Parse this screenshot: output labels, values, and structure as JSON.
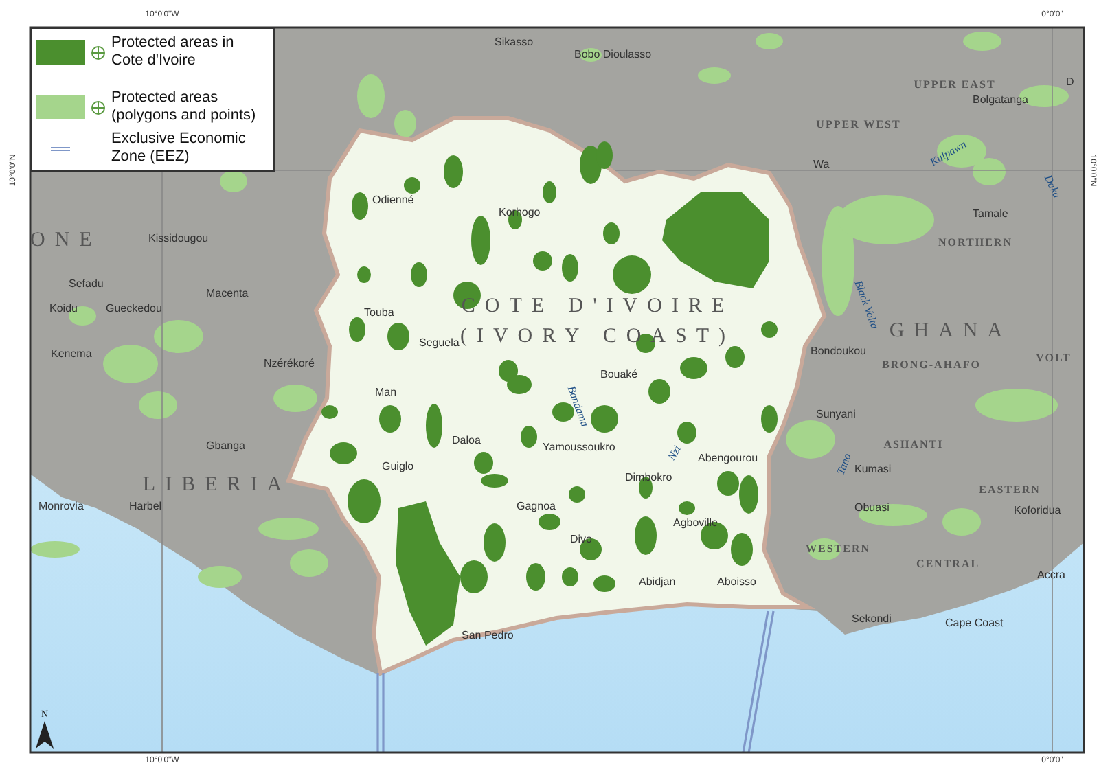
{
  "legend": {
    "items": [
      {
        "kind": "patch",
        "color": "#4b8f2e",
        "label": "Protected areas in Cote d'Ivoire"
      },
      {
        "kind": "patch",
        "color": "#a5d58c",
        "label": "Protected areas (polygons and points)"
      },
      {
        "kind": "line",
        "color": "#7f97c8",
        "label": "Exclusive Economic Zone (EEZ)"
      }
    ]
  },
  "grid_labels": {
    "top": [
      "10°0'0\"W",
      "0°0'0\""
    ],
    "bottom": [
      "10°0'0\"W",
      "0°0'0\""
    ],
    "left": [
      "10°0'0\"N"
    ],
    "right": [
      "10°0'0\"N"
    ]
  },
  "map_labels": [
    {
      "text": "COTE D'IVOIRE",
      "kind": "country"
    },
    {
      "text": "(IVORY COAST)",
      "kind": "country"
    },
    {
      "text": "LIBERIA",
      "kind": "country"
    },
    {
      "text": "GHANA",
      "kind": "country"
    },
    {
      "text": "ONE",
      "kind": "country"
    },
    {
      "text": "UPPER EAST",
      "kind": "region"
    },
    {
      "text": "UPPER WEST",
      "kind": "region"
    },
    {
      "text": "NORTHERN",
      "kind": "region"
    },
    {
      "text": "BRONG-AHAFO",
      "kind": "region"
    },
    {
      "text": "ASHANTI",
      "kind": "region"
    },
    {
      "text": "EASTERN",
      "kind": "region"
    },
    {
      "text": "WESTERN",
      "kind": "region"
    },
    {
      "text": "CENTRAL",
      "kind": "region"
    },
    {
      "text": "VOLT",
      "kind": "region"
    },
    {
      "text": "Kulpawn",
      "kind": "river"
    },
    {
      "text": "Daka",
      "kind": "river"
    },
    {
      "text": "Black Volta",
      "kind": "river"
    },
    {
      "text": "Bandama",
      "kind": "river"
    },
    {
      "text": "Nzi",
      "kind": "river"
    },
    {
      "text": "Tano",
      "kind": "river"
    },
    {
      "text": "Sikasso",
      "kind": "city"
    },
    {
      "text": "Bobo Dioulasso",
      "kind": "city"
    },
    {
      "text": "D",
      "kind": "city"
    },
    {
      "text": "Bolgatanga",
      "kind": "city"
    },
    {
      "text": "Wa",
      "kind": "city"
    },
    {
      "text": "Tamale",
      "kind": "city"
    },
    {
      "text": "Odienné",
      "kind": "city"
    },
    {
      "text": "Korhogo",
      "kind": "city"
    },
    {
      "text": "Kissidougou",
      "kind": "city"
    },
    {
      "text": "Sefadu",
      "kind": "city"
    },
    {
      "text": "Koidu",
      "kind": "city"
    },
    {
      "text": "Gueckedou",
      "kind": "city"
    },
    {
      "text": "Macenta",
      "kind": "city"
    },
    {
      "text": "Kenema",
      "kind": "city"
    },
    {
      "text": "Touba",
      "kind": "city"
    },
    {
      "text": "Seguela",
      "kind": "city"
    },
    {
      "text": "Nzérékoré",
      "kind": "city"
    },
    {
      "text": "Man",
      "kind": "city"
    },
    {
      "text": "Bouaké",
      "kind": "city"
    },
    {
      "text": "Bondoukou",
      "kind": "city"
    },
    {
      "text": "Daloa",
      "kind": "city"
    },
    {
      "text": "Yamoussoukro",
      "kind": "city"
    },
    {
      "text": "Sunyani",
      "kind": "city"
    },
    {
      "text": "Abengourou",
      "kind": "city"
    },
    {
      "text": "Dimbokro",
      "kind": "city"
    },
    {
      "text": "Guiglo",
      "kind": "city"
    },
    {
      "text": "Gbanga",
      "kind": "city"
    },
    {
      "text": "Kumasi",
      "kind": "city"
    },
    {
      "text": "Monrovia",
      "kind": "city"
    },
    {
      "text": "Harbel",
      "kind": "city"
    },
    {
      "text": "Gagnoa",
      "kind": "city"
    },
    {
      "text": "Agboville",
      "kind": "city"
    },
    {
      "text": "Obuasi",
      "kind": "city"
    },
    {
      "text": "Koforidua",
      "kind": "city"
    },
    {
      "text": "Divo",
      "kind": "city"
    },
    {
      "text": "Abidjan",
      "kind": "city"
    },
    {
      "text": "Aboisso",
      "kind": "city"
    },
    {
      "text": "Accra",
      "kind": "city"
    },
    {
      "text": "Sekondi",
      "kind": "city"
    },
    {
      "text": "Cape Coast",
      "kind": "city"
    },
    {
      "text": "San Pedro",
      "kind": "city"
    }
  ],
  "north_arrow": {
    "label": "N"
  }
}
